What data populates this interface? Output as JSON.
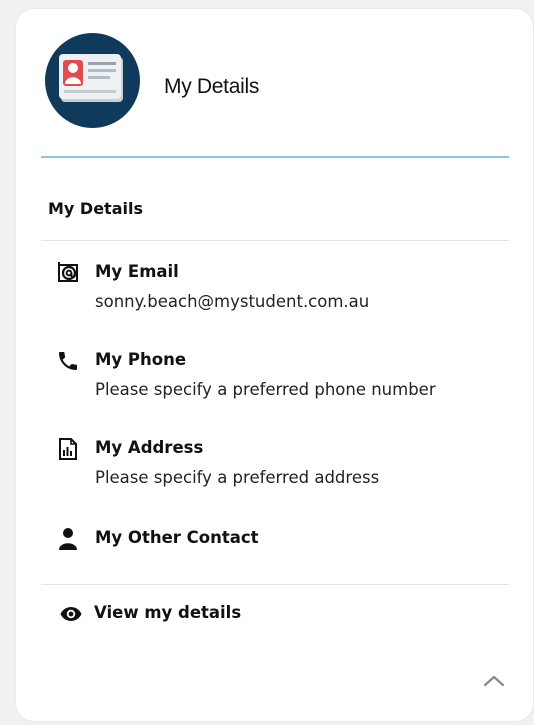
{
  "header": {
    "title": "My Details",
    "icon": "id-card-icon",
    "avatar_color": "#0f3a5b",
    "rule_color": "#8ec3e8"
  },
  "section": {
    "title": "My Details"
  },
  "items": [
    {
      "icon": "email-icon",
      "label": "My Email",
      "value": "sonny.beach@mystudent.com.au"
    },
    {
      "icon": "phone-icon",
      "label": "My Phone",
      "value": "Please specify a preferred phone number"
    },
    {
      "icon": "address-icon",
      "label": "My Address",
      "value": "Please specify a preferred address"
    },
    {
      "icon": "person-icon",
      "label": "My Other Contact",
      "value": ""
    }
  ],
  "footer": {
    "view_label": "View my details",
    "view_icon": "eye-icon",
    "collapse_icon": "chevron-up-icon"
  }
}
